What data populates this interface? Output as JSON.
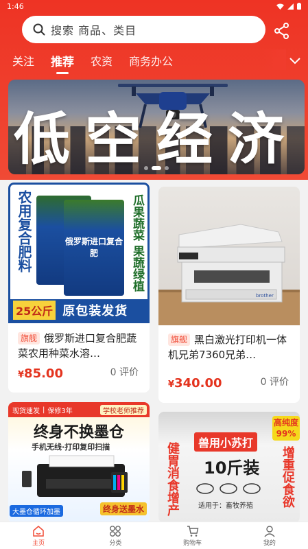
{
  "status_bar": {
    "time": "1:46"
  },
  "search": {
    "placeholder": "搜索 商品、类目",
    "icon": "search-icon"
  },
  "header": {
    "share_icon": "share-icon",
    "accent_color": "#ee3324"
  },
  "tabs": [
    {
      "label": "关注",
      "active": false
    },
    {
      "label": "推荐",
      "active": true
    },
    {
      "label": "农资",
      "active": false
    },
    {
      "label": "商务办公",
      "active": false
    }
  ],
  "banner": {
    "title": "低空经济",
    "slide_count": 3,
    "active_slide": 2
  },
  "products": [
    {
      "flag": "旗舰",
      "title": "俄罗斯进口复合肥蔬菜农用种菜水溶…",
      "currency": "¥",
      "price": "85.00",
      "reviews": "0 评价",
      "image": {
        "left_label": "农用复合肥料",
        "bag_text": "俄罗斯进口复合肥",
        "right_label": "瓜果蔬菜 果蔬绿植",
        "weight_tag": "25公斤",
        "footer_text": "原包装发货"
      }
    },
    {
      "flag": "旗舰",
      "title": "黑白激光打印机一体机兄弟7360兄弟…",
      "currency": "¥",
      "price": "340.00",
      "reviews": "0 评价",
      "image": {
        "brand": "brother"
      }
    },
    {
      "image": {
        "badge1": "现货速发",
        "badge2": "保修3年",
        "badge3": "学校老师推荐",
        "headline": "终身不换墨仓",
        "subline": "手机无线·打印复印扫描",
        "ribbon": "大墨仓循环加墨",
        "gift": "终身送墨水"
      }
    },
    {
      "image": {
        "corner": "高纯度99%",
        "headline": "兽用小苏打",
        "weight": "10斤装",
        "left_text": "健胃消食增产",
        "right_text": "增重促食欲",
        "use_text": "适用于：畜牧养殖"
      }
    }
  ],
  "bottom_nav": [
    {
      "label": "主页",
      "icon": "home-icon",
      "active": true
    },
    {
      "label": "分类",
      "icon": "category-icon",
      "active": false
    },
    {
      "label": "购物车",
      "icon": "cart-icon",
      "active": false
    },
    {
      "label": "我的",
      "icon": "profile-icon",
      "active": false
    }
  ]
}
